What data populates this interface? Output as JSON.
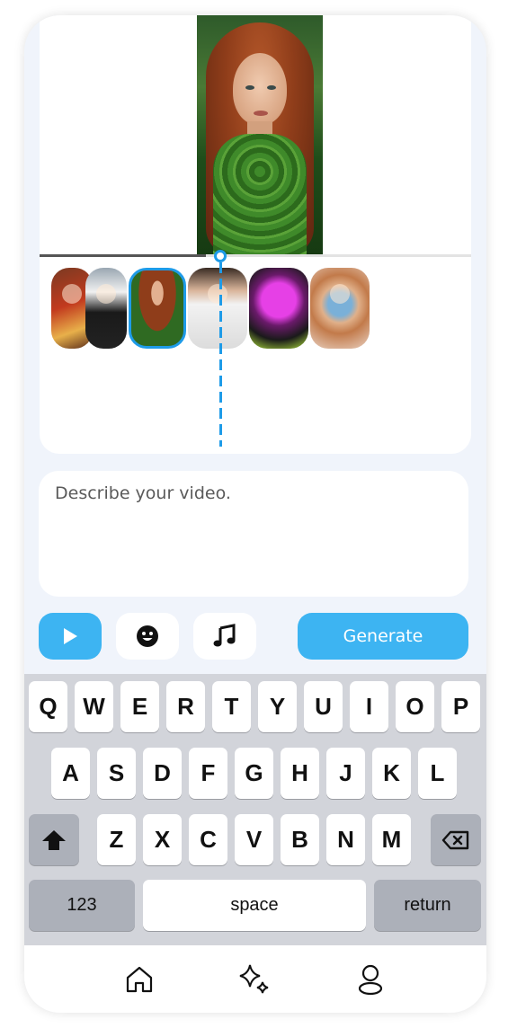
{
  "prompt": {
    "placeholder": "Describe your video."
  },
  "toolbar": {
    "play_icon": "play-icon",
    "emoji_icon": "emoji-icon",
    "music_icon": "music-note-icon",
    "generate_label": "Generate"
  },
  "timeline": {
    "clips": [
      "clip-1",
      "clip-2",
      "clip-3",
      "clip-4",
      "clip-5",
      "clip-6"
    ],
    "selected_clip_index": 2
  },
  "keyboard": {
    "row1": [
      "Q",
      "W",
      "E",
      "R",
      "T",
      "Y",
      "U",
      "I",
      "O",
      "P"
    ],
    "row2": [
      "A",
      "S",
      "D",
      "F",
      "G",
      "H",
      "J",
      "K",
      "L"
    ],
    "row3": [
      "Z",
      "X",
      "C",
      "V",
      "B",
      "N",
      "M"
    ],
    "shift_icon": "shift-icon",
    "backspace_icon": "backspace-icon",
    "numbers_label": "123",
    "space_label": "space",
    "return_label": "return"
  },
  "nav": [
    "home-icon",
    "sparkles-icon",
    "profile-icon"
  ],
  "colors": {
    "accent": "#3db4f2",
    "playhead": "#1e9be8",
    "background": "#f0f4fb"
  }
}
